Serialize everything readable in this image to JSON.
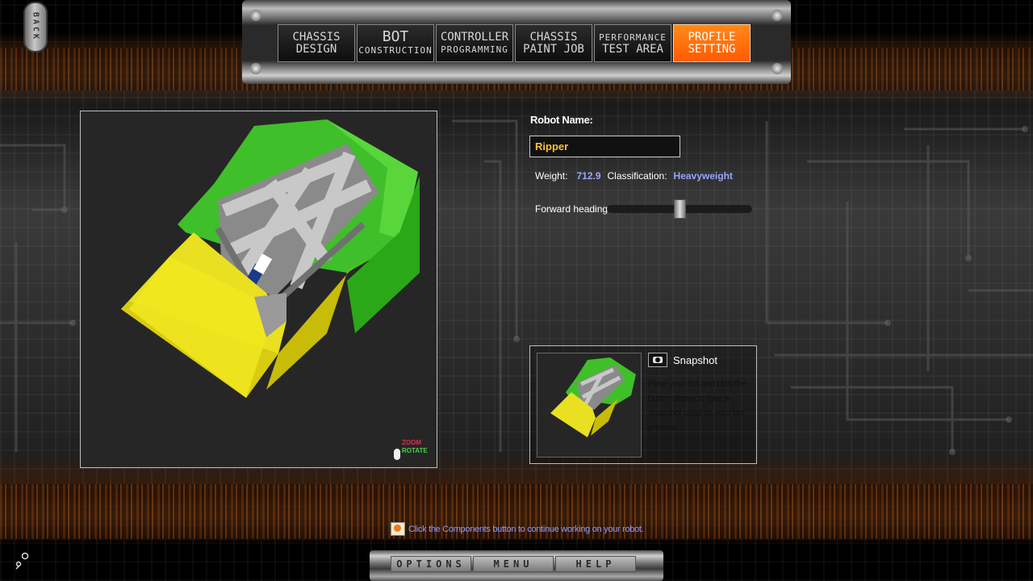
{
  "back_button": {
    "label": "BACK"
  },
  "nav": {
    "tabs": [
      {
        "line1": "CHASSIS",
        "line2": "DESIGN",
        "active": false
      },
      {
        "line1": "BOT",
        "line2": "CONSTRUCTION",
        "active": false
      },
      {
        "line1": "CONTROLLER",
        "line2": "PROGRAMMING",
        "active": false
      },
      {
        "line1": "CHASSIS",
        "line2": "PAINT JOB",
        "active": false
      },
      {
        "line1": "PERFORMANCE",
        "line2": "TEST AREA",
        "active": false
      },
      {
        "line1": "PROFILE",
        "line2": "SETTING",
        "active": true
      }
    ]
  },
  "viewport": {
    "hint_zoom": "ZOOM",
    "hint_rotate": "ROTATE"
  },
  "profile": {
    "robot_name_label": "Robot Name:",
    "robot_name_value": "Ripper",
    "weight_label": "Weight:",
    "weight_value": "712.9",
    "classification_label": "Classification:",
    "classification_value": "Heavyweight",
    "forward_heading_label": "Forward heading:",
    "forward_heading_level": 0.5
  },
  "snapshot": {
    "title": "Snapshot",
    "description": "Pose your bot and click the button above to take a snapshot used as your bot preview."
  },
  "tip": {
    "text": "Click the Components button to continue working on your robot."
  },
  "bottom_menu": {
    "options": "OPTIONS",
    "menu": "MENU",
    "help": "HELP"
  },
  "colors": {
    "accent_active_tab": "#ff6a00",
    "name_text": "#f5c23a",
    "value_text": "#9aa6ff",
    "robot_green": "#3fbf2a",
    "robot_yellow": "#f0e010"
  }
}
